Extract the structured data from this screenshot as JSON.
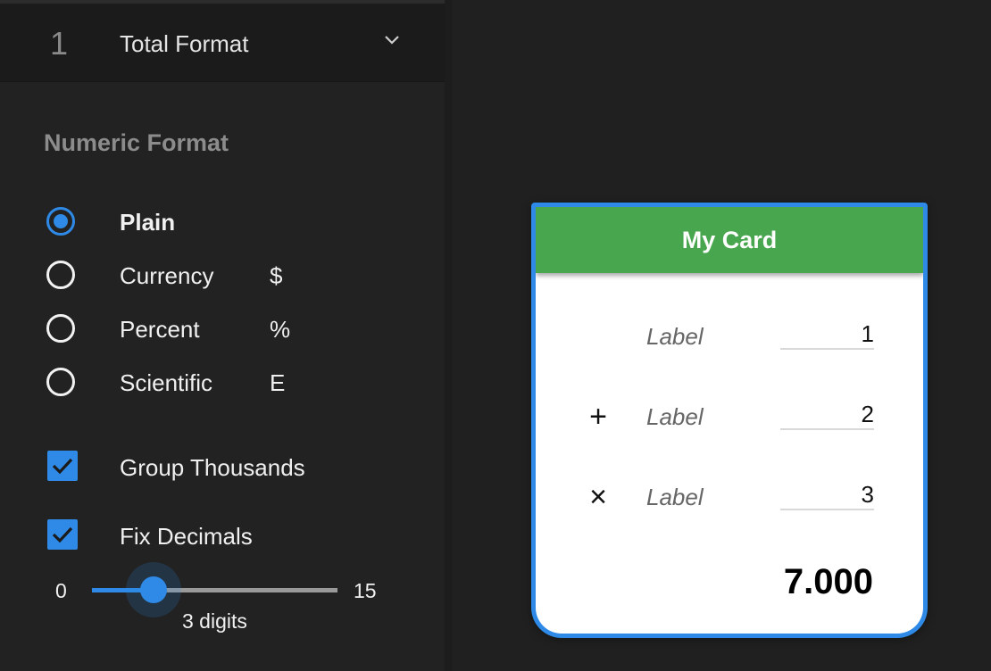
{
  "sidebar": {
    "section": {
      "number": "1",
      "title": "Total Format"
    },
    "group_title": "Numeric Format",
    "formats": [
      {
        "label": "Plain",
        "symbol": "",
        "selected": true
      },
      {
        "label": "Currency",
        "symbol": "$",
        "selected": false
      },
      {
        "label": "Percent",
        "symbol": "%",
        "selected": false
      },
      {
        "label": "Scientific",
        "symbol": "E",
        "selected": false
      }
    ],
    "options": [
      {
        "label": "Group Thousands",
        "checked": true
      },
      {
        "label": "Fix Decimals",
        "checked": true
      }
    ],
    "slider": {
      "min": "0",
      "max": "15",
      "value": 3,
      "value_label": "3 digits"
    }
  },
  "card": {
    "title": "My Card",
    "header_color": "#48a64e",
    "border_color": "#2e8ae6",
    "rows": [
      {
        "operator": "",
        "label": "Label",
        "value": "1"
      },
      {
        "operator": "+",
        "label": "Label",
        "value": "2"
      },
      {
        "operator": "×",
        "label": "Label",
        "value": "3"
      }
    ],
    "total": "7.000"
  },
  "colors": {
    "accent": "#2e8ae6",
    "background": "#202020",
    "sidebar": "#222222"
  }
}
